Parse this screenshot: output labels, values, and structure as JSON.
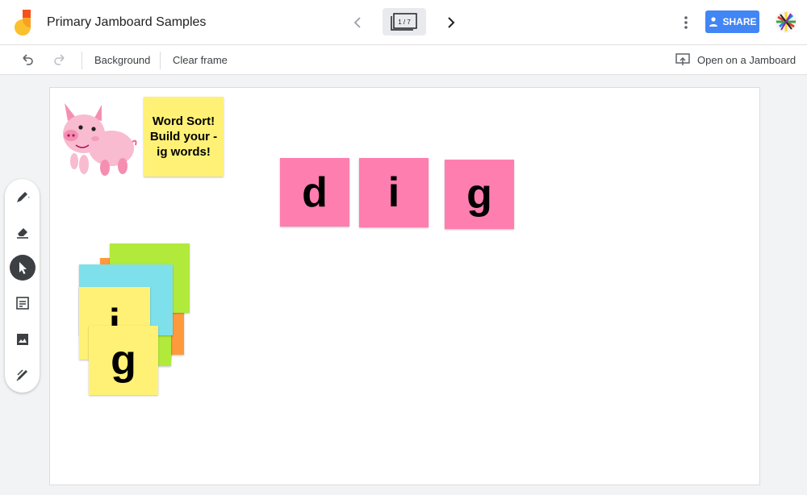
{
  "header": {
    "title": "Primary Jamboard Samples",
    "frame_indicator": "1 / 7",
    "share_label": "SHARE"
  },
  "toolbar": {
    "background_label": "Background",
    "clear_frame_label": "Clear frame",
    "open_jamboard_label": "Open on a Jamboard"
  },
  "tools": [
    "pen-icon",
    "eraser-icon",
    "select-icon",
    "sticky-note-icon",
    "image-icon",
    "laser-icon"
  ],
  "canvas": {
    "instruction_note": "Word Sort! Build your -ig words!",
    "word_notes": [
      "d",
      "i",
      "g"
    ],
    "stack_notes": [
      "i",
      "g"
    ]
  },
  "colors": {
    "share_blue": "#4285f4",
    "note_yellow": "#fff176",
    "note_pink": "#ff7eb0",
    "note_green": "#b2ea3c",
    "note_cyan": "#7ee0ea",
    "note_orange": "#ff9a3c"
  }
}
